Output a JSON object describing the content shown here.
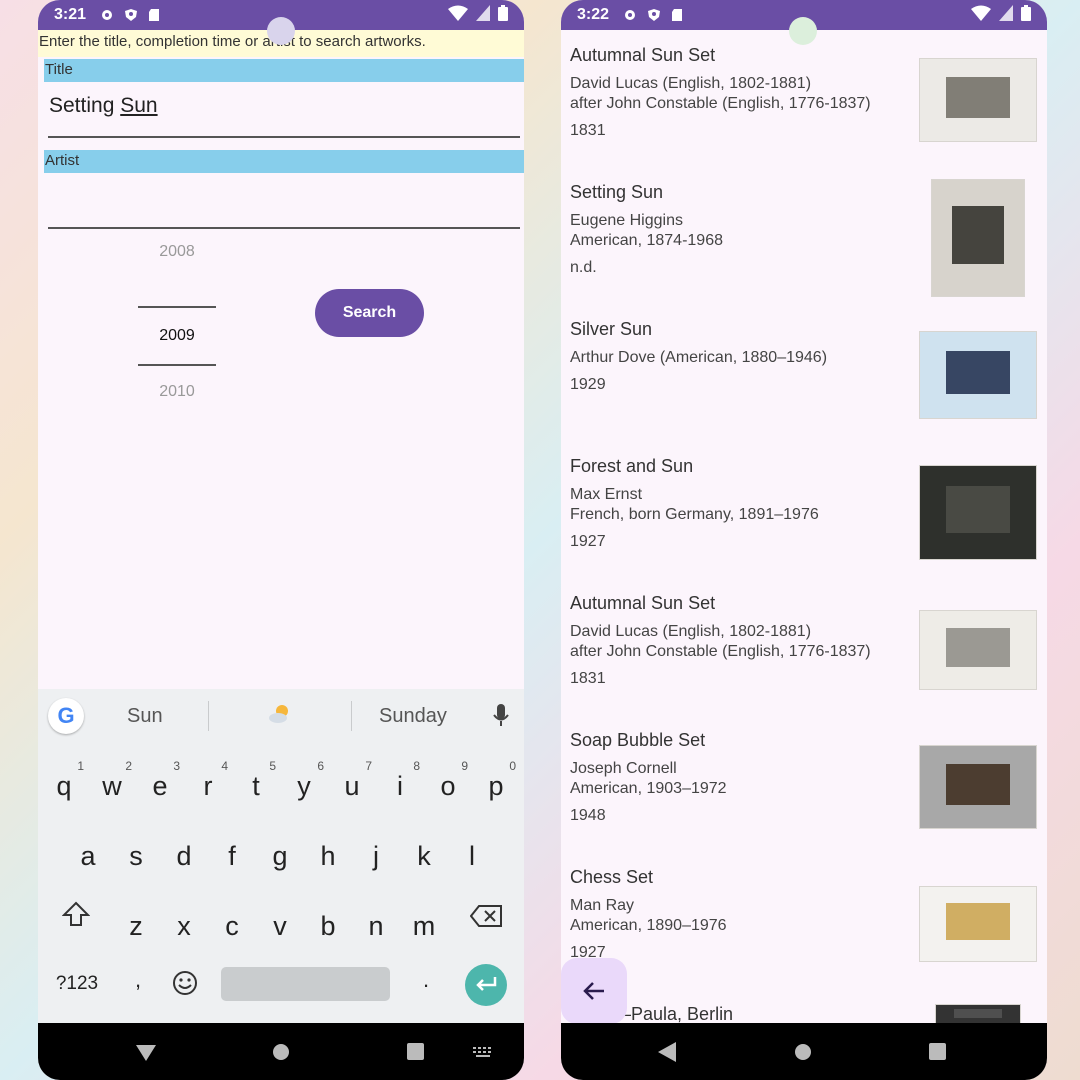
{
  "left": {
    "status": {
      "time": "3:21"
    },
    "hint": "Enter the title, completion time or artist to search artworks.",
    "title_label": "Title",
    "title_value_plain": "Setting ",
    "title_value_underlined": "Sun",
    "artist_label": "Artist",
    "artist_value": "",
    "year_picker": {
      "prev": "2008",
      "selected": "2009",
      "next": "2010"
    },
    "search_label": "Search",
    "keyboard": {
      "suggestions": [
        "Sun",
        "Sunday"
      ],
      "row1": [
        "q",
        "w",
        "e",
        "r",
        "t",
        "y",
        "u",
        "i",
        "o",
        "p"
      ],
      "row1_nums": [
        "1",
        "2",
        "3",
        "4",
        "5",
        "6",
        "7",
        "8",
        "9",
        "0"
      ],
      "row2": [
        "a",
        "s",
        "d",
        "f",
        "g",
        "h",
        "j",
        "k",
        "l"
      ],
      "row3": [
        "z",
        "x",
        "c",
        "v",
        "b",
        "n",
        "m"
      ],
      "symbols_label": "?123",
      "comma": ",",
      "period": "."
    }
  },
  "right": {
    "status": {
      "time": "3:22"
    },
    "results": [
      {
        "title": "Autumnal Sun Set",
        "artist": "David Lucas (English, 1802-1881)\nafter John Constable (English, 1776-1837)",
        "date": "1831"
      },
      {
        "title": "Setting Sun",
        "artist": "Eugene Higgins\nAmerican, 1874-1968",
        "date": "n.d."
      },
      {
        "title": "Silver Sun",
        "artist": "Arthur Dove (American, 1880–1946)",
        "date": "1929"
      },
      {
        "title": "Forest and Sun",
        "artist": "Max Ernst\nFrench, born Germany, 1891–1976",
        "date": "1927"
      },
      {
        "title": "Autumnal Sun Set",
        "artist": "David Lucas (English, 1802-1881)\nafter John Constable (English, 1776-1837)",
        "date": "1831"
      },
      {
        "title": "Soap Bubble Set",
        "artist": "Joseph Cornell\nAmerican, 1903–1972",
        "date": "1948"
      },
      {
        "title": "Chess Set",
        "artist": "Man Ray\nAmerican, 1890–1976",
        "date": "1927"
      },
      {
        "title": "...ays—Paula, Berlin",
        "artist": "",
        "date": ""
      }
    ]
  },
  "colors": {
    "accent": "#6a4ea5",
    "label_bg": "#87ceeb",
    "hint_bg": "#fffbd6",
    "enter_key": "#4db6ac"
  }
}
